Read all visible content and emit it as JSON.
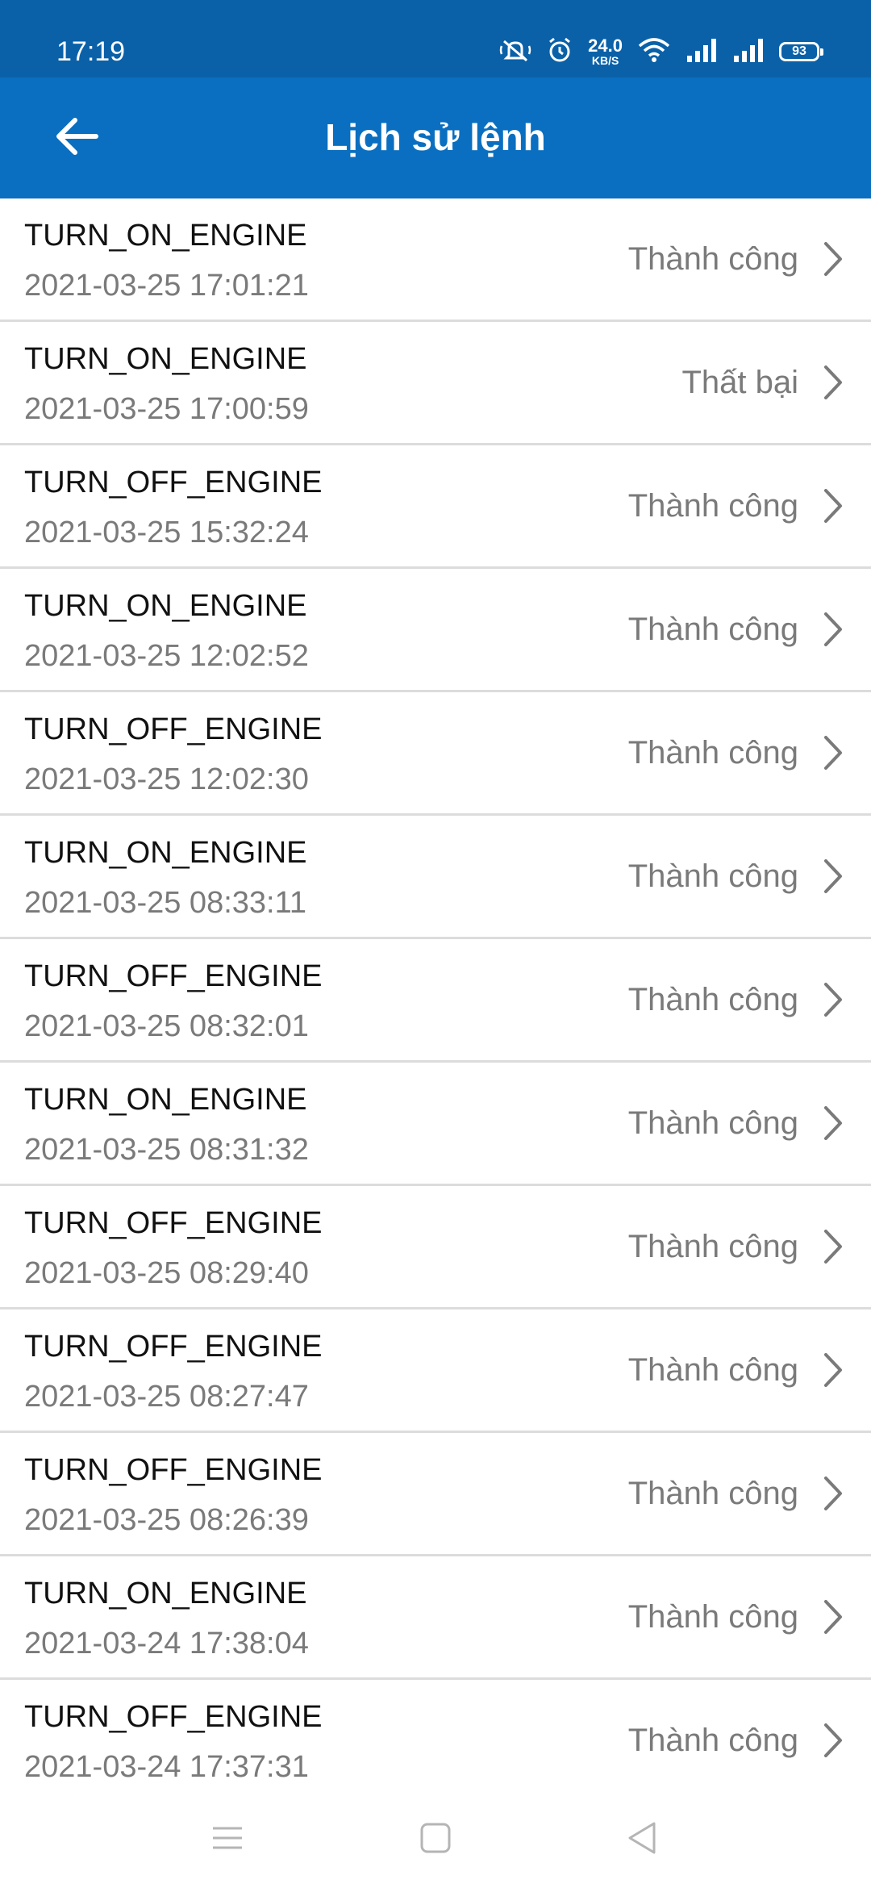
{
  "status_bar": {
    "time": "17:19",
    "net_speed_value": "24.0",
    "net_speed_unit": "KB/S",
    "battery": "93",
    "icons": [
      "mute-icon",
      "alarm-icon",
      "wifi-icon",
      "signal-icon",
      "signal-icon",
      "battery-icon"
    ]
  },
  "app_bar": {
    "title": "Lịch sử lệnh",
    "back_icon": "arrow-left-icon"
  },
  "colors": {
    "status_bar_bg": "#0a61a8",
    "app_bar_bg": "#0a6fc0",
    "primary_text": "#111111",
    "secondary_text": "#7a7a7a",
    "divider": "#dcdcdc"
  },
  "history": [
    {
      "command": "TURN_ON_ENGINE",
      "time": "2021-03-25 17:01:21",
      "status": "Thành công"
    },
    {
      "command": "TURN_ON_ENGINE",
      "time": "2021-03-25 17:00:59",
      "status": "Thất bại"
    },
    {
      "command": "TURN_OFF_ENGINE",
      "time": "2021-03-25 15:32:24",
      "status": "Thành công"
    },
    {
      "command": "TURN_ON_ENGINE",
      "time": "2021-03-25 12:02:52",
      "status": "Thành công"
    },
    {
      "command": "TURN_OFF_ENGINE",
      "time": "2021-03-25 12:02:30",
      "status": "Thành công"
    },
    {
      "command": "TURN_ON_ENGINE",
      "time": "2021-03-25 08:33:11",
      "status": "Thành công"
    },
    {
      "command": "TURN_OFF_ENGINE",
      "time": "2021-03-25 08:32:01",
      "status": "Thành công"
    },
    {
      "command": "TURN_ON_ENGINE",
      "time": "2021-03-25 08:31:32",
      "status": "Thành công"
    },
    {
      "command": "TURN_OFF_ENGINE",
      "time": "2021-03-25 08:29:40",
      "status": "Thành công"
    },
    {
      "command": "TURN_OFF_ENGINE",
      "time": "2021-03-25 08:27:47",
      "status": "Thành công"
    },
    {
      "command": "TURN_OFF_ENGINE",
      "time": "2021-03-25 08:26:39",
      "status": "Thành công"
    },
    {
      "command": "TURN_ON_ENGINE",
      "time": "2021-03-24 17:38:04",
      "status": "Thành công"
    },
    {
      "command": "TURN_OFF_ENGINE",
      "time": "2021-03-24 17:37:31",
      "status": "Thành công"
    }
  ],
  "nav_bar": {
    "icons": [
      "menu-icon",
      "home-square-icon",
      "back-triangle-icon"
    ]
  }
}
